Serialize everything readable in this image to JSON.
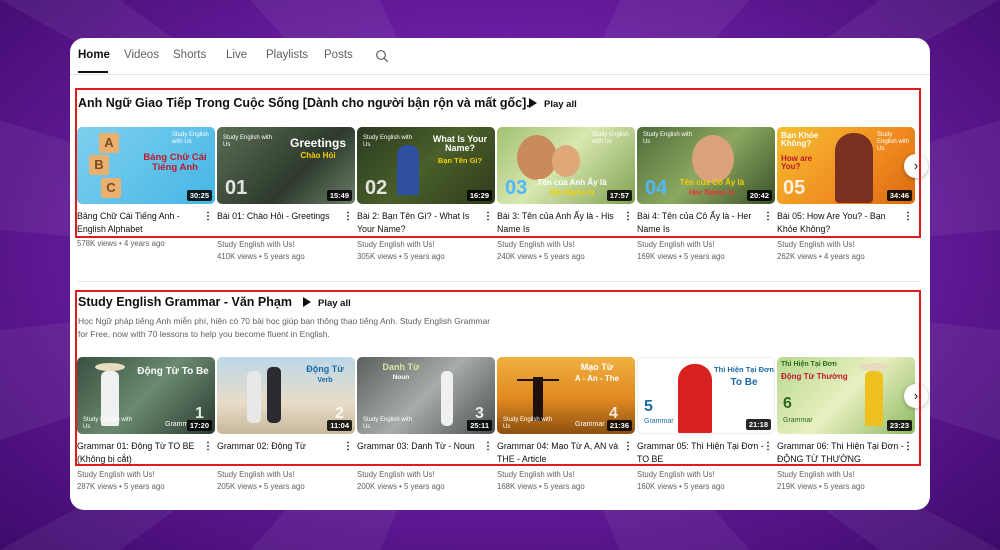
{
  "tabs": [
    {
      "label": "Home"
    },
    {
      "label": "Videos"
    },
    {
      "label": "Shorts"
    },
    {
      "label": "Live"
    },
    {
      "label": "Playlists"
    },
    {
      "label": "Posts"
    }
  ],
  "sections": [
    {
      "title": "Anh Ngữ Giao Tiếp Trong Cuộc Sống [Dành cho người bận rộn và mất gốc].",
      "play_all": "Play all",
      "videos": [
        {
          "title": "Bảng Chữ Cái Tiếng Anh - English Alphabet",
          "channel": "",
          "views": "578K views",
          "age": "4 years ago",
          "duration": "30:25",
          "thumb_text": "Bảng Chữ Cái Tiếng Anh",
          "thumb_num": ""
        },
        {
          "title": "Bài 01: Chào Hỏi - Greetings",
          "channel": "Study English with Us!",
          "views": "410K views",
          "age": "5 years ago",
          "duration": "15:49",
          "thumb_text": "Greetings",
          "thumb_sub": "Chào Hỏi",
          "thumb_num": "01"
        },
        {
          "title": "Bài 2: Bạn Tên Gì? - What Is Your Name?",
          "channel": "Study English with Us!",
          "views": "305K views",
          "age": "5 years ago",
          "duration": "16:29",
          "thumb_text": "What Is Your Name?",
          "thumb_sub": "Bạn Tên Gì?",
          "thumb_num": "02"
        },
        {
          "title": "Bài 3: Tên của Anh Ấy là - His Name Is",
          "channel": "Study English with Us!",
          "views": "240K views",
          "age": "5 years ago",
          "duration": "17:57",
          "thumb_text": "Tên của Anh Ấy là",
          "thumb_sub": "His Name Is",
          "thumb_num": "03"
        },
        {
          "title": "Bài 4: Tên của Cô Ấy là - Her Name Is",
          "channel": "Study English with Us!",
          "views": "169K views",
          "age": "5 years ago",
          "duration": "20:42",
          "thumb_text": "Tên của Cô Ấy là",
          "thumb_sub": "Her Name Is",
          "thumb_num": "04"
        },
        {
          "title": "Bài 05: How Are You? - Bạn Khỏe Không?",
          "channel": "Study English with Us!",
          "views": "262K views",
          "age": "4 years ago",
          "duration": "34:46",
          "thumb_text": "Bạn Khỏe Không?",
          "thumb_sub": "How are You?",
          "thumb_num": "05"
        }
      ]
    },
    {
      "title": "Study English Grammar - Văn Phạm",
      "play_all": "Play all",
      "description": "Học Ngữ pháp tiếng Anh miễn phí, hiện có 70 bài học giúp bạn thông thạo tiếng Anh. Study English Grammar for Free, now with 70 lessons to help you become fluent in English.",
      "videos": [
        {
          "title": "Grammar 01: Động Từ TO BE (Không bị cắt)",
          "channel": "Study English with Us!",
          "views": "287K views",
          "age": "5 years ago",
          "duration": "17:20",
          "thumb_text": "Động Từ To Be",
          "thumb_num": "1"
        },
        {
          "title": "Grammar 02: Động Từ",
          "channel": "Study English with Us!",
          "views": "205K views",
          "age": "5 years ago",
          "duration": "11:04",
          "thumb_text": "Động Từ",
          "thumb_sub": "Verb",
          "thumb_num": "2"
        },
        {
          "title": "Grammar 03: Danh Từ - Noun",
          "channel": "Study English with Us!",
          "views": "200K views",
          "age": "5 years ago",
          "duration": "25:11",
          "thumb_text": "Danh Từ",
          "thumb_sub": "Noun",
          "thumb_num": "3"
        },
        {
          "title": "Grammar 04: Mạo Từ A, AN và THE - Article",
          "channel": "Study English with Us!",
          "views": "168K views",
          "age": "5 years ago",
          "duration": "21:36",
          "thumb_text": "Mạo Từ",
          "thumb_sub": "A - An - The",
          "thumb_num": "4"
        },
        {
          "title": "Grammar 05: Thì Hiện Tại Đơn - TO BE",
          "channel": "Study English with Us!",
          "views": "160K views",
          "age": "5 years ago",
          "duration": "21:18",
          "thumb_text": "Thì Hiện Tại Đơn",
          "thumb_sub": "To Be",
          "thumb_num": "5"
        },
        {
          "title": "Grammar 06: Thì Hiện Tại Đơn - ĐỘNG TỪ THƯỜNG",
          "channel": "Study English with Us!",
          "views": "219K views",
          "age": "5 years ago",
          "duration": "23:23",
          "thumb_text": "Thì Hiện Tại Đơn",
          "thumb_sub": "Động Từ Thường",
          "thumb_num": "6"
        }
      ]
    }
  ],
  "thumb_brand": "Study English with Us",
  "thumb_label_grammar": "Grammar",
  "icons": {
    "search": "search-icon",
    "more": "more-vert-icon",
    "next": "chevron-right-icon",
    "play": "play-icon"
  },
  "colors": {
    "highlight": "#e01b1b",
    "accent_yellow": "#f5d000"
  }
}
